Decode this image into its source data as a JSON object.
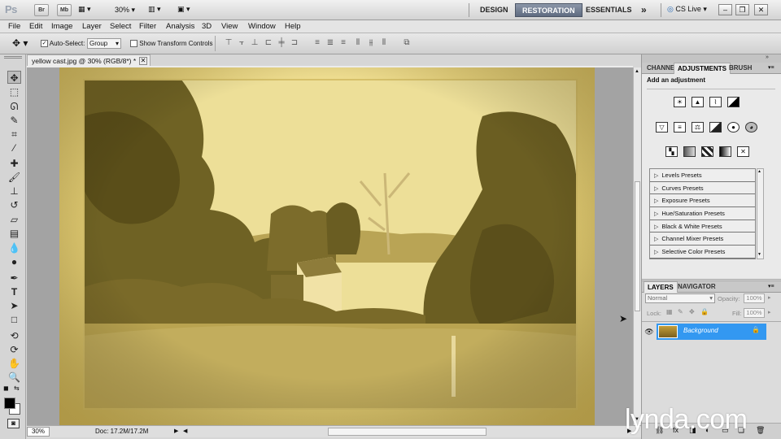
{
  "appbar": {
    "logo": "Ps",
    "bridge_label": "Br",
    "minibridge_label": "Mb",
    "zoom": "30%",
    "workspaces": [
      "DESIGN",
      "RESTORATION",
      "ESSENTIALS"
    ],
    "more": "»",
    "cs_live": "CS Live"
  },
  "menu": [
    "File",
    "Edit",
    "Image",
    "Layer",
    "Select",
    "Filter",
    "Analysis",
    "3D",
    "View",
    "Window",
    "Help"
  ],
  "options": {
    "auto_select_label": "Auto-Select:",
    "auto_select_value": "Group",
    "show_transform_label": "Show Transform Controls"
  },
  "document": {
    "tab_title": "yellow cast.jpg @ 30% (RGB/8*) *",
    "zoom_status": "30%",
    "doc_info": "Doc: 17.2M/17.2M"
  },
  "panels": {
    "tabs_top": [
      "CHANNE",
      "ADJUSTMENTS",
      "BRUSH"
    ],
    "add_adjustment": "Add an adjustment",
    "presets": [
      "Levels Presets",
      "Curves Presets",
      "Exposure Presets",
      "Hue/Saturation Presets",
      "Black & White Presets",
      "Channel Mixer Presets",
      "Selective Color Presets"
    ],
    "tabs_layers": [
      "LAYERS",
      "NAVIGATOR"
    ],
    "blend_mode": "Normal",
    "opacity_label": "Opacity:",
    "opacity_value": "100%",
    "lock_label": "Lock:",
    "fill_label": "Fill:",
    "fill_value": "100%",
    "layer_name": "Background"
  },
  "watermark": "lynda.com",
  "colors": {
    "selected_layer": "#3398f1",
    "photo_tint": "#e3cc74"
  }
}
